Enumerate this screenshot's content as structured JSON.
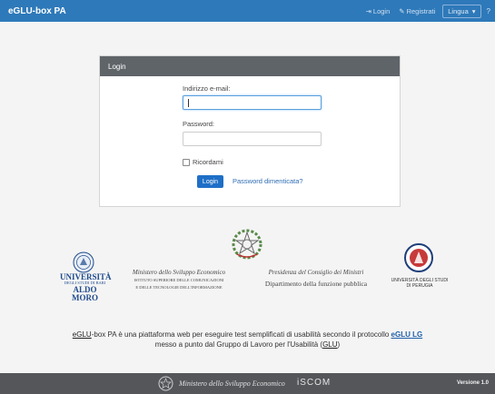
{
  "header": {
    "brand": "eGLU-box PA",
    "login_link": "Login",
    "register_link": "Registrati",
    "language_label": "Lingua",
    "help_label": "?"
  },
  "login_card": {
    "title": "Login",
    "email_label": "Indirizzo e-mail:",
    "email_value": "",
    "password_label": "Password:",
    "password_value": "",
    "remember_label": "Ricordami",
    "login_button": "Login",
    "forgot_link": "Password dimenticata?"
  },
  "logos": {
    "uniba_line1": "UNIVERSITÀ",
    "uniba_line2": "DEGLI STUDI DI BARI",
    "uniba_line3": "ALDO MORO",
    "ministry_script": "Ministero dello Sviluppo Economico",
    "ministry_line1": "ISTITUTO SUPERIORE DELLE COMUNICAZIONI",
    "ministry_line2": "E DELLE TECNOLOGIE DELL'INFORMAZIONE",
    "pcm_script": "Presidenza del Consiglio dei Ministri",
    "pcm_dept": "Dipartimento della funzione pubblica",
    "perugia_line1": "UNIVERSITÀ DEGLI STUDI",
    "perugia_line2": "DI PERUGIA"
  },
  "description": {
    "brand": "eGLU",
    "text1": "-box PA è una piattaforma web per eseguire test semplificati di usabilità secondo il protocollo ",
    "protocol": "eGLU LG",
    "text2": "messo a punto dal Gruppo di Lavoro per l'Usabilità (",
    "glu": "GLU",
    "text3": ")"
  },
  "footer": {
    "ministry_script": "Ministero dello Sviluppo Economico",
    "iscom": "iSCOM",
    "version": "Versione 1.0"
  },
  "colors": {
    "topbar": "#2e79b9",
    "card_header": "#5f6469",
    "primary_button": "#1f6fc7",
    "footer": "#54565a"
  }
}
